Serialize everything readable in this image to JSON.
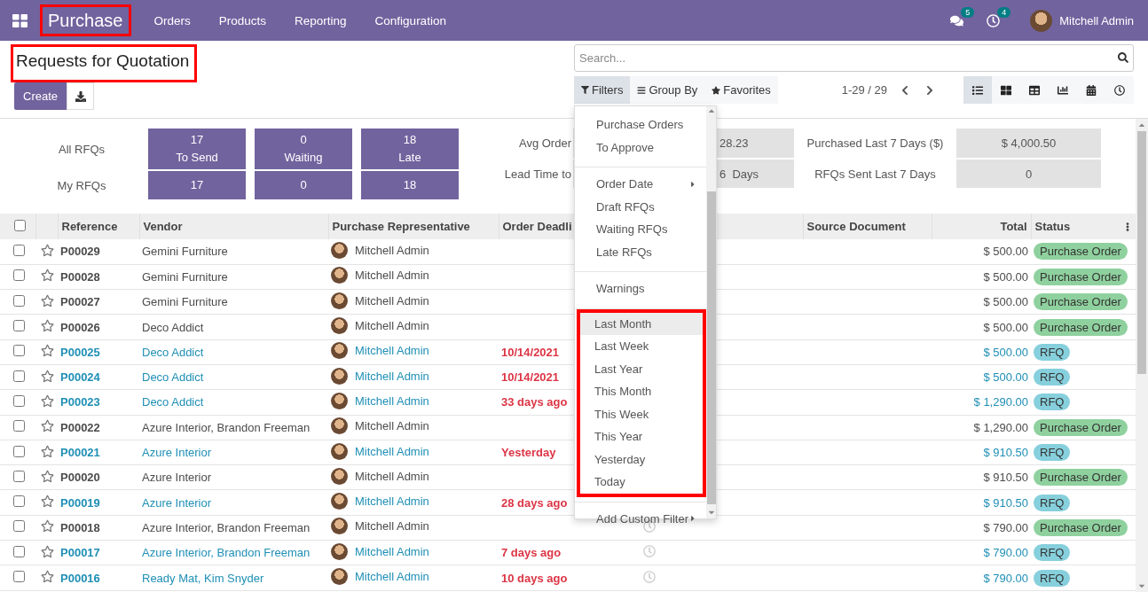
{
  "navbar": {
    "app_title": "Purchase",
    "app_title_highlighted": true,
    "menu": [
      "Orders",
      "Products",
      "Reporting",
      "Configuration"
    ],
    "messages_badge": "5",
    "activities_badge": "4",
    "user": "Mitchell Admin"
  },
  "control_panel": {
    "title": "Requests for Quotation",
    "title_highlighted": true,
    "create_button": "Create",
    "search": {
      "placeholder": "Search..."
    },
    "filter_buttons": [
      {
        "label": "Filters",
        "kind": "filter",
        "selected": true
      },
      {
        "label": "Group By",
        "kind": "group",
        "selected": false
      },
      {
        "label": "Favorites",
        "kind": "favorite",
        "selected": false
      }
    ],
    "pager": "1-29 / 29",
    "views": [
      {
        "kind": "list",
        "selected": true
      },
      {
        "kind": "kanban",
        "selected": false
      },
      {
        "kind": "pivot",
        "selected": false
      },
      {
        "kind": "graph",
        "selected": false
      },
      {
        "kind": "calendar",
        "selected": false
      },
      {
        "kind": "activity",
        "selected": false
      }
    ]
  },
  "filters_menu": {
    "sections": [
      {
        "highlighted": false,
        "items": [
          {
            "label": "Purchase Orders",
            "hovered": false,
            "submenu": false
          },
          {
            "label": "To Approve",
            "hovered": false,
            "submenu": false
          }
        ]
      },
      {
        "highlighted": false,
        "items": [
          {
            "label": "Order Date",
            "hovered": false,
            "submenu": true
          },
          {
            "label": "Draft RFQs",
            "hovered": false,
            "submenu": false
          },
          {
            "label": "Waiting RFQs",
            "hovered": false,
            "submenu": false
          },
          {
            "label": "Late RFQs",
            "hovered": false,
            "submenu": false
          }
        ]
      },
      {
        "highlighted": false,
        "items": [
          {
            "label": "Warnings",
            "hovered": false,
            "submenu": false
          }
        ]
      },
      {
        "highlighted": true,
        "items": [
          {
            "label": "Last Month",
            "hovered": true,
            "submenu": false
          },
          {
            "label": "Last Week",
            "hovered": false,
            "submenu": false
          },
          {
            "label": "Last Year",
            "hovered": false,
            "submenu": false
          },
          {
            "label": "This Month",
            "hovered": false,
            "submenu": false
          },
          {
            "label": "This Week",
            "hovered": false,
            "submenu": false
          },
          {
            "label": "This Year",
            "hovered": false,
            "submenu": false
          },
          {
            "label": "Yesterday",
            "hovered": false,
            "submenu": false
          },
          {
            "label": "Today",
            "hovered": false,
            "submenu": false
          }
        ]
      },
      {
        "highlighted": false,
        "items": [
          {
            "label": "Add Custom Filter",
            "hovered": false,
            "submenu": true
          }
        ]
      }
    ]
  },
  "dashboard": {
    "row_labels": [
      "All RFQs",
      "My RFQs"
    ],
    "tiles": [
      {
        "all_count": "17",
        "label": "To Send",
        "my_count": "17"
      },
      {
        "all_count": "0",
        "label": "Waiting",
        "my_count": "0"
      },
      {
        "all_count": "18",
        "label": "Late",
        "my_count": "18"
      }
    ],
    "stats": [
      {
        "label": "Avg Order",
        "value": "28.23",
        "label_2": "Purchased Last 7 Days ($)",
        "value_2": "$ 4,000.50"
      },
      {
        "label": "Lead Time to",
        "value": "6  Days",
        "label_2": "RFQs Sent Last 7 Days",
        "value_2": "0"
      }
    ]
  },
  "table": {
    "all_selected": false,
    "columns": [
      "Reference",
      "Vendor",
      "Purchase Representative",
      "Order Deadli",
      "Source Document",
      "Total",
      "Status"
    ],
    "rows": [
      {
        "selected": false,
        "starred": false,
        "kind": "order",
        "reference": "P00029",
        "vendor": "Gemini Furniture",
        "representative": "Mitchell Admin",
        "total": "$ 500.00",
        "status": "Purchase Order"
      },
      {
        "selected": false,
        "starred": false,
        "kind": "order",
        "reference": "P00028",
        "vendor": "Gemini Furniture",
        "representative": "Mitchell Admin",
        "total": "$ 500.00",
        "status": "Purchase Order"
      },
      {
        "selected": false,
        "starred": false,
        "kind": "order",
        "reference": "P00027",
        "vendor": "Gemini Furniture",
        "representative": "Mitchell Admin",
        "total": "$ 500.00",
        "status": "Purchase Order"
      },
      {
        "selected": false,
        "starred": false,
        "kind": "order",
        "reference": "P00026",
        "vendor": "Deco Addict",
        "representative": "Mitchell Admin",
        "total": "$ 500.00",
        "status": "Purchase Order"
      },
      {
        "selected": false,
        "starred": false,
        "kind": "rfq",
        "reference": "P00025",
        "vendor": "Deco Addict",
        "representative": "Mitchell Admin",
        "deadline": "10/14/2021",
        "total": "$ 500.00",
        "status": "RFQ"
      },
      {
        "selected": false,
        "starred": false,
        "kind": "rfq",
        "reference": "P00024",
        "vendor": "Deco Addict",
        "representative": "Mitchell Admin",
        "deadline": "10/14/2021",
        "total": "$ 500.00",
        "status": "RFQ"
      },
      {
        "selected": false,
        "starred": false,
        "kind": "rfq",
        "reference": "P00023",
        "vendor": "Deco Addict",
        "representative": "Mitchell Admin",
        "deadline": "33 days ago",
        "total": "$ 1,290.00",
        "status": "RFQ"
      },
      {
        "selected": false,
        "starred": false,
        "kind": "order",
        "reference": "P00022",
        "vendor": "Azure Interior, Brandon Freeman",
        "representative": "Mitchell Admin",
        "total": "$ 1,290.00",
        "status": "Purchase Order"
      },
      {
        "selected": false,
        "starred": false,
        "kind": "rfq",
        "reference": "P00021",
        "vendor": "Azure Interior",
        "representative": "Mitchell Admin",
        "deadline": "Yesterday",
        "total": "$ 910.50",
        "status": "RFQ"
      },
      {
        "selected": false,
        "starred": false,
        "kind": "order",
        "reference": "P00020",
        "vendor": "Azure Interior",
        "representative": "Mitchell Admin",
        "total": "$ 910.50",
        "status": "Purchase Order"
      },
      {
        "selected": false,
        "starred": false,
        "kind": "rfq",
        "reference": "P00019",
        "vendor": "Azure Interior",
        "representative": "Mitchell Admin",
        "deadline": "28 days ago",
        "total": "$ 910.50",
        "status": "RFQ"
      },
      {
        "selected": false,
        "starred": false,
        "kind": "order",
        "reference": "P00018",
        "vendor": "Azure Interior, Brandon Freeman",
        "representative": "Mitchell Admin",
        "activity": true,
        "total": "$ 790.00",
        "status": "Purchase Order"
      },
      {
        "selected": false,
        "starred": false,
        "kind": "rfq",
        "reference": "P00017",
        "vendor": "Azure Interior, Brandon Freeman",
        "representative": "Mitchell Admin",
        "deadline": "7 days ago",
        "activity": true,
        "total": "$ 790.00",
        "status": "RFQ"
      },
      {
        "selected": false,
        "starred": false,
        "kind": "rfq",
        "reference": "P00016",
        "vendor": "Ready Mat, Kim Snyder",
        "representative": "Mitchell Admin",
        "deadline": "10 days ago",
        "activity": true,
        "total": "$ 790.00",
        "status": "RFQ"
      }
    ]
  }
}
